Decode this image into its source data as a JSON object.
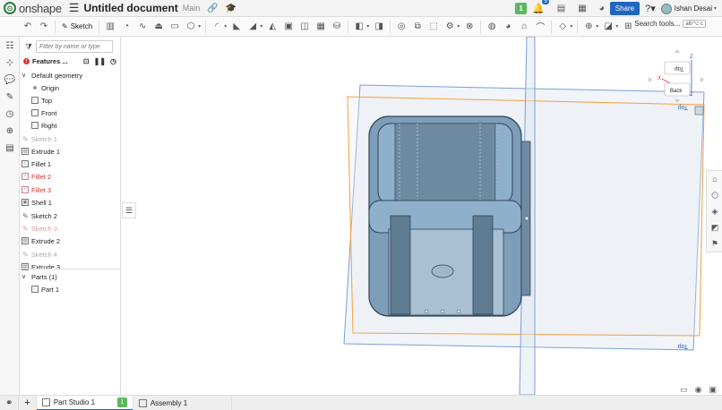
{
  "app": {
    "logo_text": "onshape",
    "document_title": "Untitled document",
    "branch": "Main"
  },
  "header": {
    "notification_count": "5",
    "green_badge": "1",
    "share_label": "Share",
    "user_name": "Ishan Desai"
  },
  "toolbar": {
    "sketch_label": "Sketch",
    "search_label": "Search tools...",
    "search_shortcut": "alt/⌥ c"
  },
  "feature_panel": {
    "filter_placeholder": "Filter by name or type",
    "header_label": "Features ...",
    "default_geometry_label": "Default geometry",
    "default_geometry": [
      "Origin",
      "Top",
      "Front",
      "Right"
    ],
    "features": [
      {
        "name": "Sketch 1",
        "state": "suppressed"
      },
      {
        "name": "Extrude 1",
        "state": "normal"
      },
      {
        "name": "Fillet 1",
        "state": "normal"
      },
      {
        "name": "Fillet 2",
        "state": "error"
      },
      {
        "name": "Fillet 3",
        "state": "error"
      },
      {
        "name": "Shell 1",
        "state": "normal"
      },
      {
        "name": "Sketch 2",
        "state": "normal"
      },
      {
        "name": "Sketch 3",
        "state": "error-sketch"
      },
      {
        "name": "Extrude 2",
        "state": "normal"
      },
      {
        "name": "Sketch 4",
        "state": "suppressed"
      },
      {
        "name": "Extrude 3",
        "state": "normal"
      }
    ],
    "parts_label": "Parts (1)",
    "parts": [
      "Part 1"
    ]
  },
  "viewcube": {
    "top_label": "Top",
    "back_label": "Back",
    "z_label": "Z",
    "x_label": "X"
  },
  "viewport": {
    "plane_label_top": "Top",
    "plane_label_bottom": "Top"
  },
  "tabs": [
    {
      "label": "Part Studio 1",
      "badge": "1",
      "active": true
    },
    {
      "label": "Assembly 1",
      "active": false
    }
  ],
  "colors": {
    "accent": "#1f66c1",
    "part_fill": "#7d9db8",
    "plane_orange": "#f0a040",
    "plane_blue": "#7aa0d8"
  }
}
